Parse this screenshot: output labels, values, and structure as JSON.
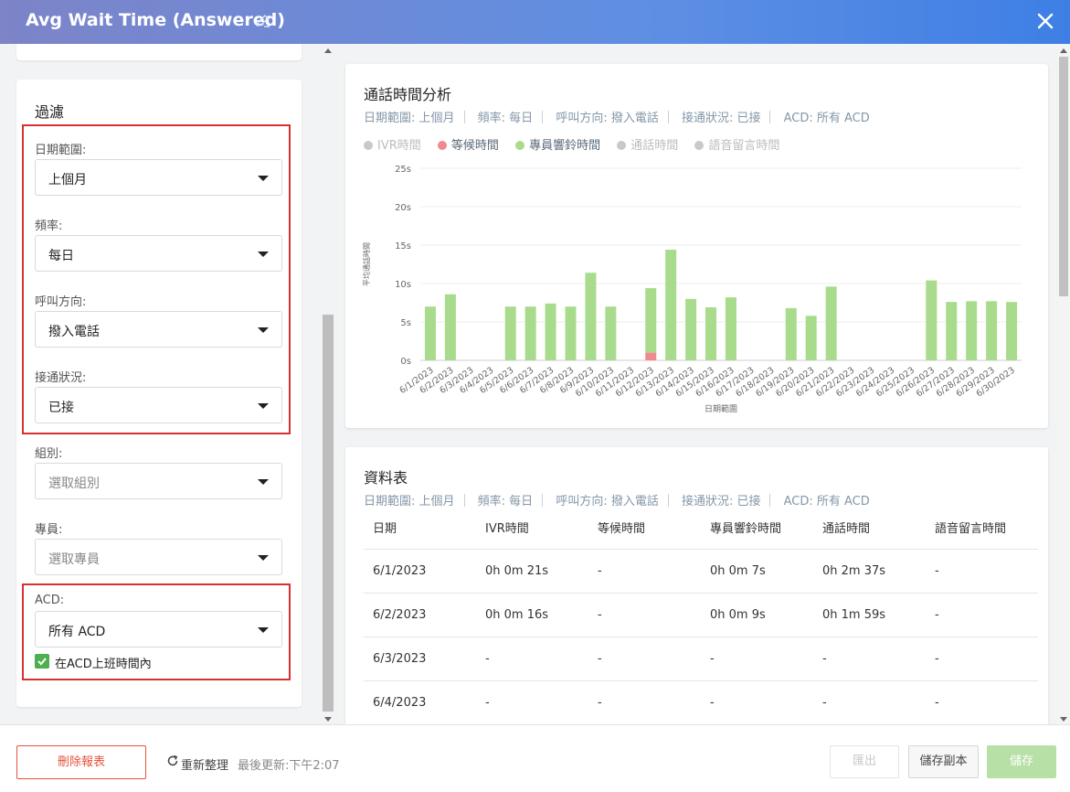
{
  "header": {
    "title": "Avg Wait Time (Answered)"
  },
  "filter": {
    "title": "過濾",
    "date_range": {
      "label": "日期範圍:",
      "value": "上個月"
    },
    "frequency": {
      "label": "頻率:",
      "value": "每日"
    },
    "call_direction": {
      "label": "呼叫方向:",
      "value": "撥入電話"
    },
    "connect_status": {
      "label": "接通狀況:",
      "value": "已接"
    },
    "group": {
      "label": "組別:",
      "placeholder": "選取組別"
    },
    "agent": {
      "label": "專員:",
      "placeholder": "選取專員"
    },
    "acd": {
      "label": "ACD:",
      "value": "所有 ACD"
    },
    "acd_hours": {
      "label": "在ACD上班時間內",
      "checked": true
    }
  },
  "chart_card": {
    "title": "通話時間分析",
    "meta": [
      "日期範圍: 上個月",
      "頻率: 每日",
      "呼叫方向: 撥入電話",
      "接通狀況: 已接",
      "ACD: 所有 ACD"
    ],
    "legend": [
      {
        "label": "IVR時間",
        "color": "#c9c9c9",
        "active": false
      },
      {
        "label": "等候時間",
        "color": "#f08a8f",
        "active": true
      },
      {
        "label": "專員響鈴時間",
        "color": "#a8dc8c",
        "active": true
      },
      {
        "label": "通話時間",
        "color": "#c9c9c9",
        "active": false
      },
      {
        "label": "語音留言時間",
        "color": "#c9c9c9",
        "active": false
      }
    ]
  },
  "chart_data": {
    "type": "bar",
    "title": "",
    "xlabel": "日期範圍",
    "ylabel": "平均通話時間",
    "ylim": [
      0,
      25
    ],
    "yticks": [
      "0s",
      "5s",
      "10s",
      "15s",
      "20s",
      "25s"
    ],
    "categories": [
      "6/1/2023",
      "6/2/2023",
      "6/3/2023",
      "6/4/2023",
      "6/5/2023",
      "6/6/2023",
      "6/7/2023",
      "6/8/2023",
      "6/9/2023",
      "6/10/2023",
      "6/11/2023",
      "6/12/2023",
      "6/13/2023",
      "6/14/2023",
      "6/15/2023",
      "6/16/2023",
      "6/17/2023",
      "6/18/2023",
      "6/19/2023",
      "6/20/2023",
      "6/21/2023",
      "6/22/2023",
      "6/23/2023",
      "6/24/2023",
      "6/25/2023",
      "6/26/2023",
      "6/27/2023",
      "6/28/2023",
      "6/29/2023",
      "6/30/2023"
    ],
    "series": [
      {
        "name": "等候時間",
        "color": "#f08a8f",
        "values": [
          0,
          0,
          0,
          0,
          0,
          0,
          0,
          0,
          0,
          0,
          0,
          1,
          0,
          0,
          0,
          0,
          0,
          0,
          0,
          0,
          0,
          0,
          0,
          0,
          0,
          0,
          0,
          0,
          0,
          0
        ]
      },
      {
        "name": "專員響鈴時間",
        "color": "#a8dc8c",
        "values": [
          7,
          8.6,
          0,
          0,
          7,
          7,
          7.4,
          7,
          11.4,
          7,
          0,
          8.4,
          14.4,
          8,
          6.9,
          8.2,
          0,
          0,
          6.8,
          5.8,
          9.6,
          0,
          0,
          0,
          0,
          10.4,
          7.6,
          7.7,
          7.7,
          7.6
        ]
      }
    ],
    "grid": true,
    "legend_position": "top-left"
  },
  "table_card": {
    "title": "資料表",
    "meta": [
      "日期範圍: 上個月",
      "頻率: 每日",
      "呼叫方向: 撥入電話",
      "接通狀況: 已接",
      "ACD: 所有 ACD"
    ],
    "columns": [
      "日期",
      "IVR時間",
      "等候時間",
      "專員響鈴時間",
      "通話時間",
      "語音留言時間"
    ],
    "rows": [
      [
        "6/1/2023",
        "0h 0m 21s",
        "-",
        "0h 0m 7s",
        "0h 2m 37s",
        "-"
      ],
      [
        "6/2/2023",
        "0h 0m 16s",
        "-",
        "0h 0m 9s",
        "0h 1m 59s",
        "-"
      ],
      [
        "6/3/2023",
        "-",
        "-",
        "-",
        "-",
        "-"
      ],
      [
        "6/4/2023",
        "-",
        "-",
        "-",
        "-",
        "-"
      ]
    ]
  },
  "footer": {
    "delete_label": "刪除報表",
    "refresh_label": "重新整理",
    "updated_label": "最後更新:下午2:07",
    "export_label": "匯出",
    "copy_label": "儲存副本",
    "save_label": "儲存"
  }
}
